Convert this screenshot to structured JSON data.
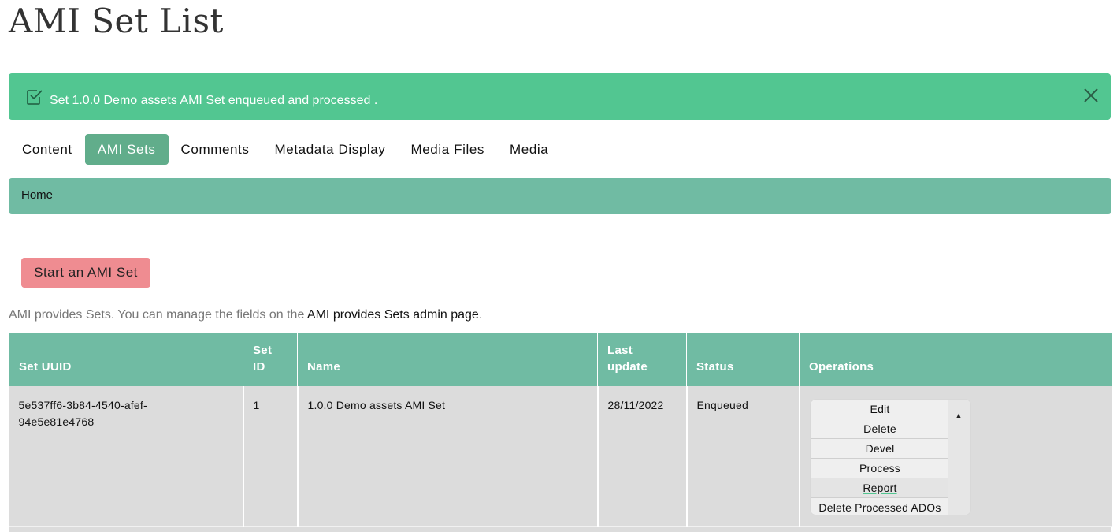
{
  "page": {
    "title": "AMI Set List"
  },
  "alert": {
    "message": "Set 1.0.0 Demo assets AMI Set enqueued and processed .",
    "status_icon": "check-square-icon",
    "close_icon": "close-icon",
    "color": "#52c691"
  },
  "tabs": [
    {
      "label": "Content",
      "active": false
    },
    {
      "label": "AMI Sets",
      "active": true
    },
    {
      "label": "Comments",
      "active": false
    },
    {
      "label": "Metadata Display",
      "active": false
    },
    {
      "label": "Media Files",
      "active": false
    },
    {
      "label": "Media",
      "active": false
    }
  ],
  "breadcrumb": {
    "home": "Home"
  },
  "actions": {
    "start_label": "Start an AMI Set"
  },
  "help": {
    "prefix": "AMI provides Sets. You can manage the fields on the ",
    "link": "AMI provides Sets admin page",
    "suffix": "."
  },
  "table": {
    "headers": {
      "uuid": "Set UUID",
      "id_line1": "Set",
      "id_line2": "ID",
      "name": "Name",
      "updated_line1": "Last",
      "updated_line2": "update",
      "status": "Status",
      "operations": "Operations"
    },
    "rows": [
      {
        "uuid_line1": "5e537ff6-3b84-4540-afef-",
        "uuid_line2": "94e5e81e4768",
        "id": "1",
        "name": "1.0.0 Demo assets AMI Set",
        "updated": "28/11/2022",
        "status": "Enqueued",
        "operations": [
          "Edit",
          "Delete",
          "Devel",
          "Process",
          "Report",
          "Delete Processed ADOs"
        ]
      }
    ]
  },
  "colors": {
    "header_bg": "#70bba3",
    "active_tab": "#61ad8b",
    "start_button": "#ef8c91",
    "row_bg": "#dcdcdc"
  }
}
